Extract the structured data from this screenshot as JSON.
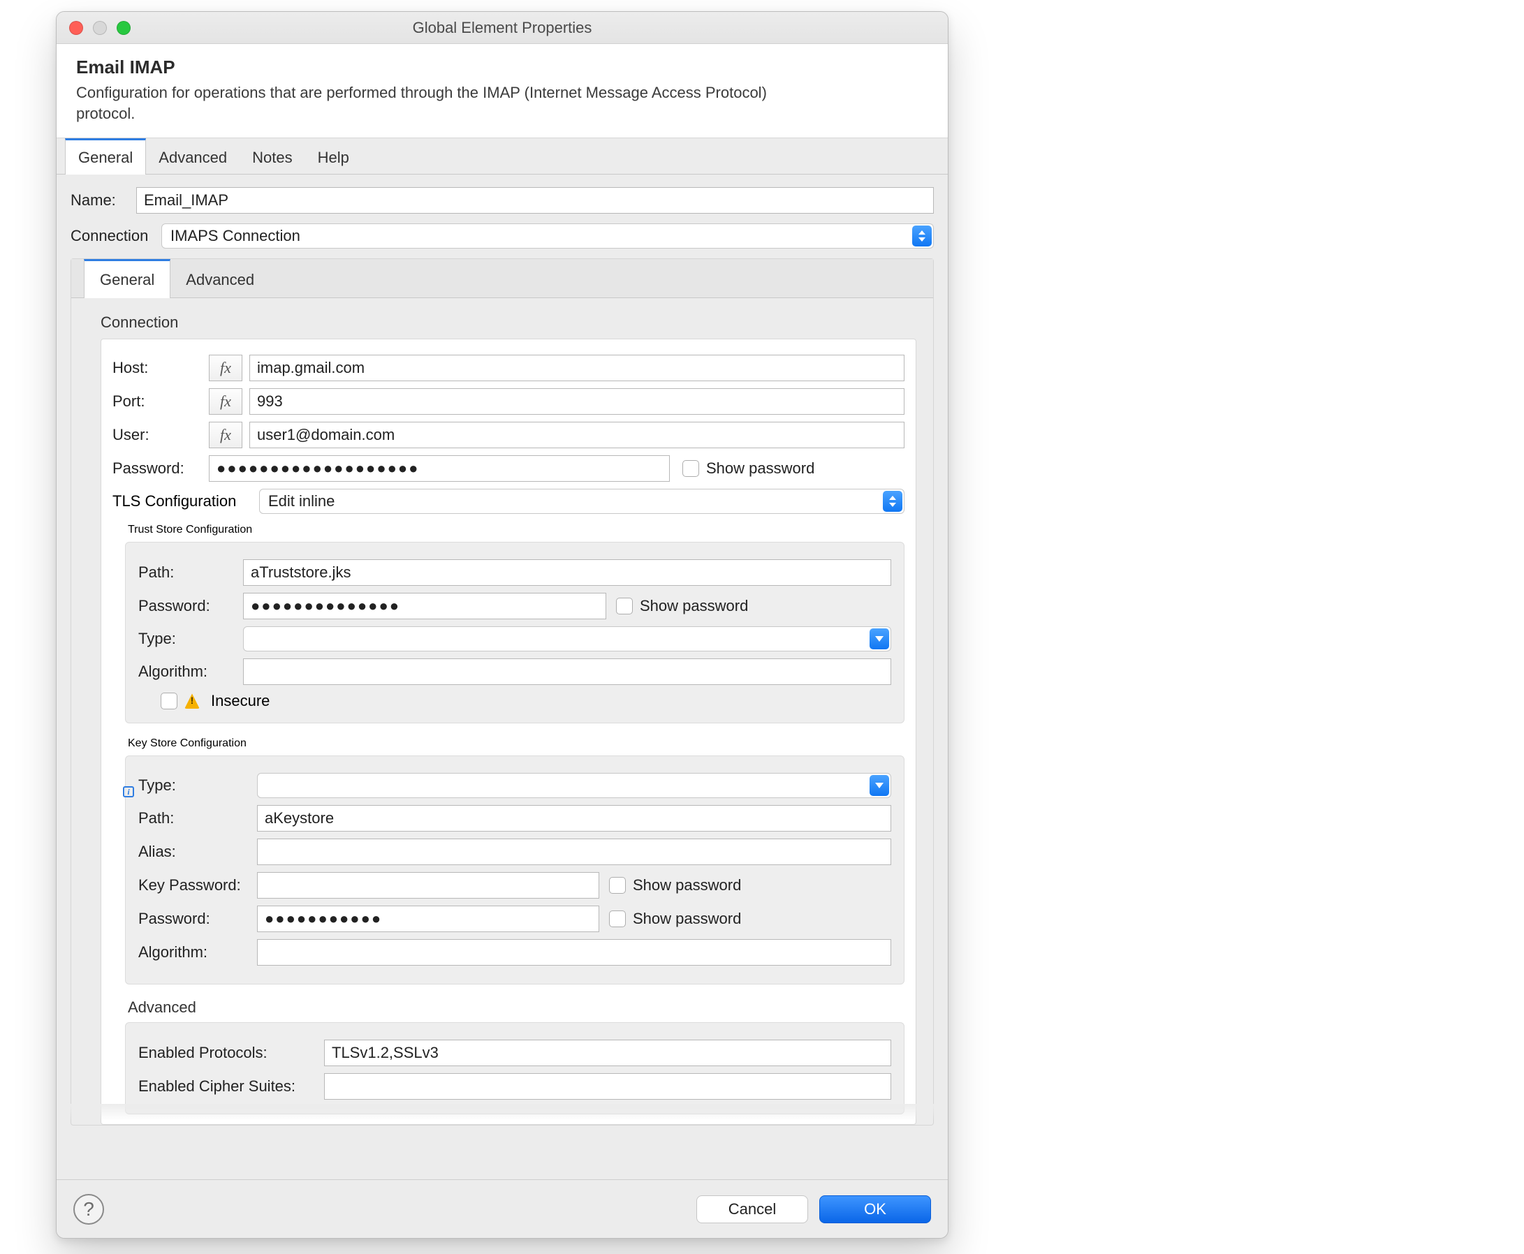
{
  "window": {
    "title": "Global Element Properties"
  },
  "header": {
    "title": "Email IMAP",
    "subtitle": "Configuration for operations that are performed through the IMAP (Internet Message Access Protocol) protocol."
  },
  "tabs": {
    "general": "General",
    "advanced": "Advanced",
    "notes": "Notes",
    "help": "Help"
  },
  "fields": {
    "name_label": "Name:",
    "name_value": "Email_IMAP",
    "connection_label": "Connection",
    "connection_value": "IMAPS Connection"
  },
  "sub_tabs": {
    "general": "General",
    "advanced": "Advanced"
  },
  "connection_section": {
    "title": "Connection",
    "host_label": "Host:",
    "host_value": "imap.gmail.com",
    "port_label": "Port:",
    "port_value": "993",
    "user_label": "User:",
    "user_value": "user1@domain.com",
    "password_label": "Password:",
    "password_value": "●●●●●●●●●●●●●●●●●●●",
    "show_password": "Show password",
    "tls_label": "TLS Configuration",
    "tls_value": "Edit inline"
  },
  "trust_store": {
    "title": "Trust Store Configuration",
    "path_label": "Path:",
    "path_value": "aTruststore.jks",
    "password_label": "Password:",
    "password_value": "●●●●●●●●●●●●●●",
    "show_password": "Show password",
    "type_label": "Type:",
    "algorithm_label": "Algorithm:",
    "insecure_label": "Insecure"
  },
  "key_store": {
    "title": "Key Store Configuration",
    "type_label": "Type:",
    "path_label": "Path:",
    "path_value": "aKeystore",
    "alias_label": "Alias:",
    "keypassword_label": "Key Password:",
    "show_password1": "Show password",
    "password_label": "Password:",
    "password_value": "●●●●●●●●●●●",
    "show_password2": "Show password",
    "algorithm_label": "Algorithm:"
  },
  "advanced_group": {
    "title": "Advanced",
    "protocols_label": "Enabled Protocols:",
    "protocols_value": "TLSv1.2,SSLv3",
    "ciphers_label": "Enabled Cipher Suites:"
  },
  "footer": {
    "cancel": "Cancel",
    "ok": "OK"
  },
  "fx": "fx"
}
